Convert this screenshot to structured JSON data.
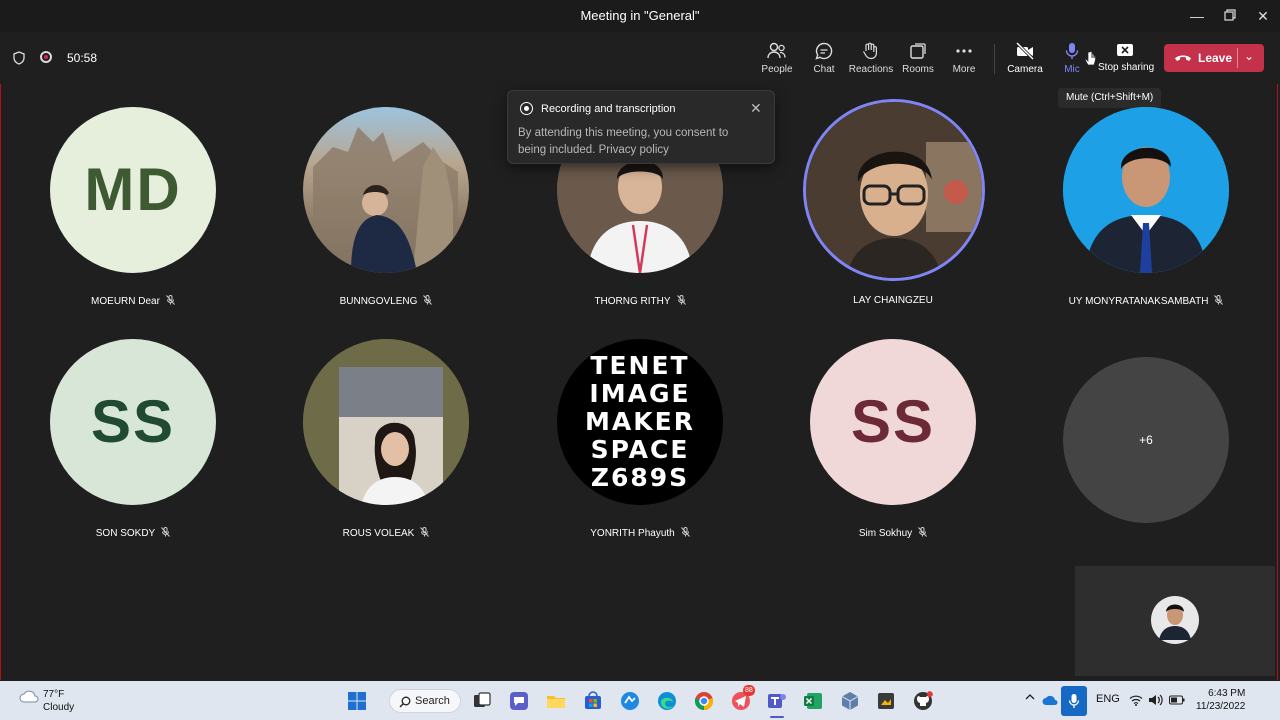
{
  "window": {
    "title": "Meeting in \"General\""
  },
  "meeting": {
    "timer": "50:58"
  },
  "toolbar": {
    "people": "People",
    "chat": "Chat",
    "reactions": "Reactions",
    "rooms": "Rooms",
    "more": "More",
    "camera": "Camera",
    "mic": "Mic",
    "stop_sharing": "Stop sharing",
    "leave": "Leave"
  },
  "tooltip": {
    "mute": "Mute (Ctrl+Shift+M)"
  },
  "toast": {
    "title": "Recording and transcription",
    "body": "By attending this meeting, you consent to being included.",
    "link": "Privacy policy"
  },
  "participants": [
    {
      "name": "MOEURN Dear",
      "initials": "MD",
      "muted": true
    },
    {
      "name": "BUNNGOVLENG",
      "muted": true
    },
    {
      "name": "THORNG RITHY",
      "muted": true
    },
    {
      "name": "LAY CHAINGZEU",
      "muted": false,
      "speaking": true
    },
    {
      "name": "UY MONYRATANAKSAMBATH",
      "muted": true
    },
    {
      "name": "SON SOKDY",
      "initials": "SS",
      "muted": true
    },
    {
      "name": "ROUS VOLEAK",
      "muted": true
    },
    {
      "name": "YONRITH Phayuth",
      "muted": true
    },
    {
      "name": "Sim Sokhuy",
      "initials": "SS",
      "muted": true
    }
  ],
  "logo_tile": {
    "lines": [
      "TENET",
      "IMAGE",
      "MAKER",
      "SPACE",
      "Z689S"
    ]
  },
  "overflow": {
    "label": "+6"
  },
  "colors": {
    "leave": "#c4314b",
    "mic_active": "#7f85f5",
    "speaking_ring": "#7f85f5"
  },
  "taskbar": {
    "temp": "77°F",
    "condition": "Cloudy",
    "search": "Search",
    "lang": "ENG",
    "time": "6:43 PM",
    "date": "11/23/2022",
    "badge_count": "88"
  }
}
